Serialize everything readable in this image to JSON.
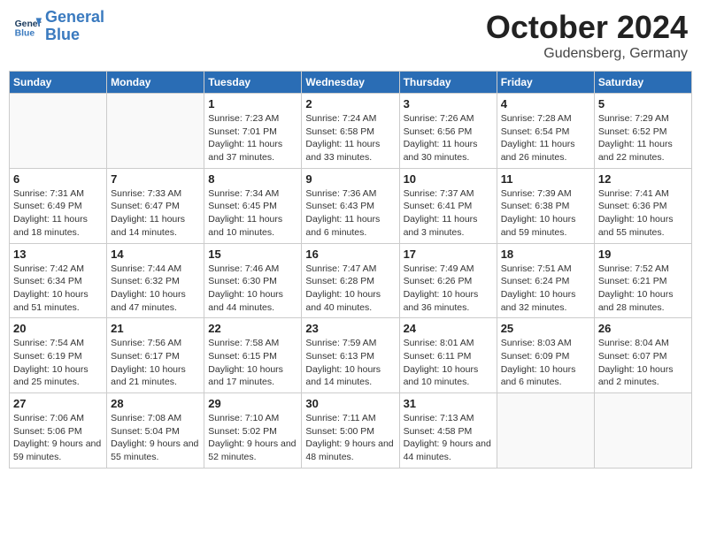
{
  "header": {
    "logo_line1": "General",
    "logo_line2": "Blue",
    "month": "October 2024",
    "location": "Gudensberg, Germany"
  },
  "weekdays": [
    "Sunday",
    "Monday",
    "Tuesday",
    "Wednesday",
    "Thursday",
    "Friday",
    "Saturday"
  ],
  "weeks": [
    [
      {
        "day": "",
        "info": ""
      },
      {
        "day": "",
        "info": ""
      },
      {
        "day": "1",
        "info": "Sunrise: 7:23 AM\nSunset: 7:01 PM\nDaylight: 11 hours and 37 minutes."
      },
      {
        "day": "2",
        "info": "Sunrise: 7:24 AM\nSunset: 6:58 PM\nDaylight: 11 hours and 33 minutes."
      },
      {
        "day": "3",
        "info": "Sunrise: 7:26 AM\nSunset: 6:56 PM\nDaylight: 11 hours and 30 minutes."
      },
      {
        "day": "4",
        "info": "Sunrise: 7:28 AM\nSunset: 6:54 PM\nDaylight: 11 hours and 26 minutes."
      },
      {
        "day": "5",
        "info": "Sunrise: 7:29 AM\nSunset: 6:52 PM\nDaylight: 11 hours and 22 minutes."
      }
    ],
    [
      {
        "day": "6",
        "info": "Sunrise: 7:31 AM\nSunset: 6:49 PM\nDaylight: 11 hours and 18 minutes."
      },
      {
        "day": "7",
        "info": "Sunrise: 7:33 AM\nSunset: 6:47 PM\nDaylight: 11 hours and 14 minutes."
      },
      {
        "day": "8",
        "info": "Sunrise: 7:34 AM\nSunset: 6:45 PM\nDaylight: 11 hours and 10 minutes."
      },
      {
        "day": "9",
        "info": "Sunrise: 7:36 AM\nSunset: 6:43 PM\nDaylight: 11 hours and 6 minutes."
      },
      {
        "day": "10",
        "info": "Sunrise: 7:37 AM\nSunset: 6:41 PM\nDaylight: 11 hours and 3 minutes."
      },
      {
        "day": "11",
        "info": "Sunrise: 7:39 AM\nSunset: 6:38 PM\nDaylight: 10 hours and 59 minutes."
      },
      {
        "day": "12",
        "info": "Sunrise: 7:41 AM\nSunset: 6:36 PM\nDaylight: 10 hours and 55 minutes."
      }
    ],
    [
      {
        "day": "13",
        "info": "Sunrise: 7:42 AM\nSunset: 6:34 PM\nDaylight: 10 hours and 51 minutes."
      },
      {
        "day": "14",
        "info": "Sunrise: 7:44 AM\nSunset: 6:32 PM\nDaylight: 10 hours and 47 minutes."
      },
      {
        "day": "15",
        "info": "Sunrise: 7:46 AM\nSunset: 6:30 PM\nDaylight: 10 hours and 44 minutes."
      },
      {
        "day": "16",
        "info": "Sunrise: 7:47 AM\nSunset: 6:28 PM\nDaylight: 10 hours and 40 minutes."
      },
      {
        "day": "17",
        "info": "Sunrise: 7:49 AM\nSunset: 6:26 PM\nDaylight: 10 hours and 36 minutes."
      },
      {
        "day": "18",
        "info": "Sunrise: 7:51 AM\nSunset: 6:24 PM\nDaylight: 10 hours and 32 minutes."
      },
      {
        "day": "19",
        "info": "Sunrise: 7:52 AM\nSunset: 6:21 PM\nDaylight: 10 hours and 28 minutes."
      }
    ],
    [
      {
        "day": "20",
        "info": "Sunrise: 7:54 AM\nSunset: 6:19 PM\nDaylight: 10 hours and 25 minutes."
      },
      {
        "day": "21",
        "info": "Sunrise: 7:56 AM\nSunset: 6:17 PM\nDaylight: 10 hours and 21 minutes."
      },
      {
        "day": "22",
        "info": "Sunrise: 7:58 AM\nSunset: 6:15 PM\nDaylight: 10 hours and 17 minutes."
      },
      {
        "day": "23",
        "info": "Sunrise: 7:59 AM\nSunset: 6:13 PM\nDaylight: 10 hours and 14 minutes."
      },
      {
        "day": "24",
        "info": "Sunrise: 8:01 AM\nSunset: 6:11 PM\nDaylight: 10 hours and 10 minutes."
      },
      {
        "day": "25",
        "info": "Sunrise: 8:03 AM\nSunset: 6:09 PM\nDaylight: 10 hours and 6 minutes."
      },
      {
        "day": "26",
        "info": "Sunrise: 8:04 AM\nSunset: 6:07 PM\nDaylight: 10 hours and 2 minutes."
      }
    ],
    [
      {
        "day": "27",
        "info": "Sunrise: 7:06 AM\nSunset: 5:06 PM\nDaylight: 9 hours and 59 minutes."
      },
      {
        "day": "28",
        "info": "Sunrise: 7:08 AM\nSunset: 5:04 PM\nDaylight: 9 hours and 55 minutes."
      },
      {
        "day": "29",
        "info": "Sunrise: 7:10 AM\nSunset: 5:02 PM\nDaylight: 9 hours and 52 minutes."
      },
      {
        "day": "30",
        "info": "Sunrise: 7:11 AM\nSunset: 5:00 PM\nDaylight: 9 hours and 48 minutes."
      },
      {
        "day": "31",
        "info": "Sunrise: 7:13 AM\nSunset: 4:58 PM\nDaylight: 9 hours and 44 minutes."
      },
      {
        "day": "",
        "info": ""
      },
      {
        "day": "",
        "info": ""
      }
    ]
  ]
}
